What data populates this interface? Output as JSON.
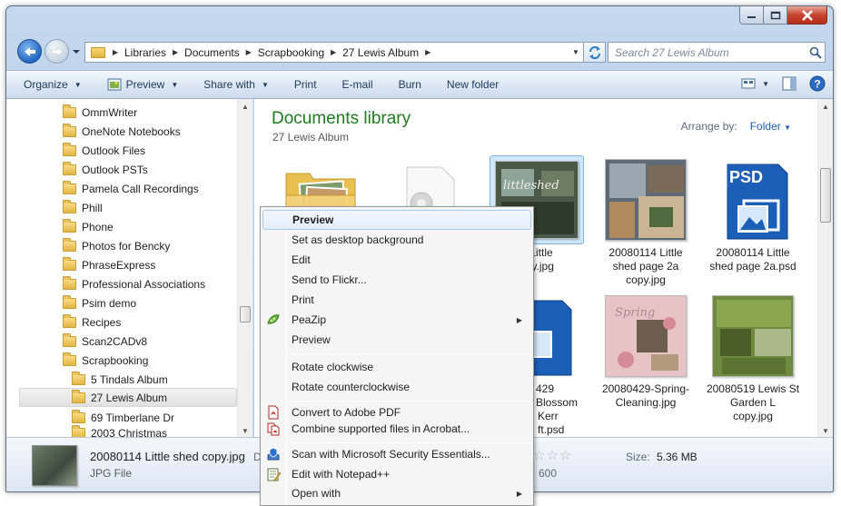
{
  "window": {
    "caption_buttons": [
      "minimize-icon",
      "maximize-icon",
      "close-icon"
    ]
  },
  "address": {
    "crumbs": [
      "Libraries",
      "Documents",
      "Scrapbooking",
      "27 Lewis Album"
    ]
  },
  "search": {
    "placeholder": "Search 27 Lewis Album"
  },
  "toolbar": {
    "organize": "Organize",
    "preview": "Preview",
    "share_with": "Share with",
    "print": "Print",
    "email": "E-mail",
    "burn": "Burn",
    "new_folder": "New folder"
  },
  "nav": {
    "items": [
      "OmmWriter",
      "OneNote Notebooks",
      "Outlook Files",
      "Outlook PSTs",
      "Pamela Call Recordings",
      "Phill",
      "Phone",
      "Photos for Bencky",
      "PhraseExpress",
      "Professional Associations",
      "Psim demo",
      "Recipes",
      "Scan2CADv8",
      "Scrapbooking",
      "5 Tindals Album",
      "27 Lewis Album",
      "69 Timberlane Dr",
      "2003 Christmas"
    ],
    "selected": "27 Lewis Album"
  },
  "library": {
    "title": "Documents library",
    "subtitle": "27 Lewis Album",
    "arrange_label": "Arrange by:",
    "arrange_value": "Folder"
  },
  "files": [
    {
      "name": "",
      "kind": "folder"
    },
    {
      "name": "",
      "kind": "settings-file"
    },
    {
      "name": "4 Little",
      "name2": "opy.jpg",
      "kind": "photo",
      "selected": true
    },
    {
      "name": "20080114 Little",
      "name2": "shed page 2a",
      "name3": "copy.jpg",
      "kind": "photo"
    },
    {
      "name": "20080114 Little",
      "name2": "shed page 2a.psd",
      "kind": "psd"
    },
    {
      "name": "429",
      "name2": "Blossom",
      "name3": "Kerr",
      "name4": "ft.psd",
      "kind": "psd"
    },
    {
      "name": "20080429-Spring-",
      "name2": "Cleaning.jpg",
      "kind": "photo"
    },
    {
      "name": "20080519 Lewis St",
      "name2": "Garden L",
      "name3": "copy.jpg",
      "kind": "photo"
    }
  ],
  "details": {
    "name": "20080114 Little shed copy.jpg",
    "type": "JPG File",
    "fragment_left": "D",
    "fragment_right": "600",
    "size_label": "Size:",
    "size_value": "5.36 MB",
    "rating": 0
  },
  "context_menu": {
    "items": [
      {
        "label": "Preview",
        "default": true,
        "highlighted": true
      },
      {
        "label": "Set as desktop background"
      },
      {
        "label": "Edit"
      },
      {
        "label": "Send to Flickr..."
      },
      {
        "label": "Print"
      },
      {
        "label": "PeaZip",
        "icon": "peazip-icon",
        "submenu": true
      },
      {
        "label": "Preview"
      },
      {
        "label": "Rotate clockwise"
      },
      {
        "label": "Rotate counterclockwise"
      },
      {
        "label": "Convert to Adobe PDF",
        "icon": "adobe-pdf-icon"
      },
      {
        "label": "Combine supported files in Acrobat...",
        "icon": "acrobat-combine-icon"
      },
      {
        "label": "Scan with Microsoft Security Essentials...",
        "icon": "security-essentials-icon"
      },
      {
        "label": "Edit with Notepad++",
        "icon": "notepadpp-icon"
      },
      {
        "label": "Open with",
        "submenu": true
      }
    ]
  }
}
